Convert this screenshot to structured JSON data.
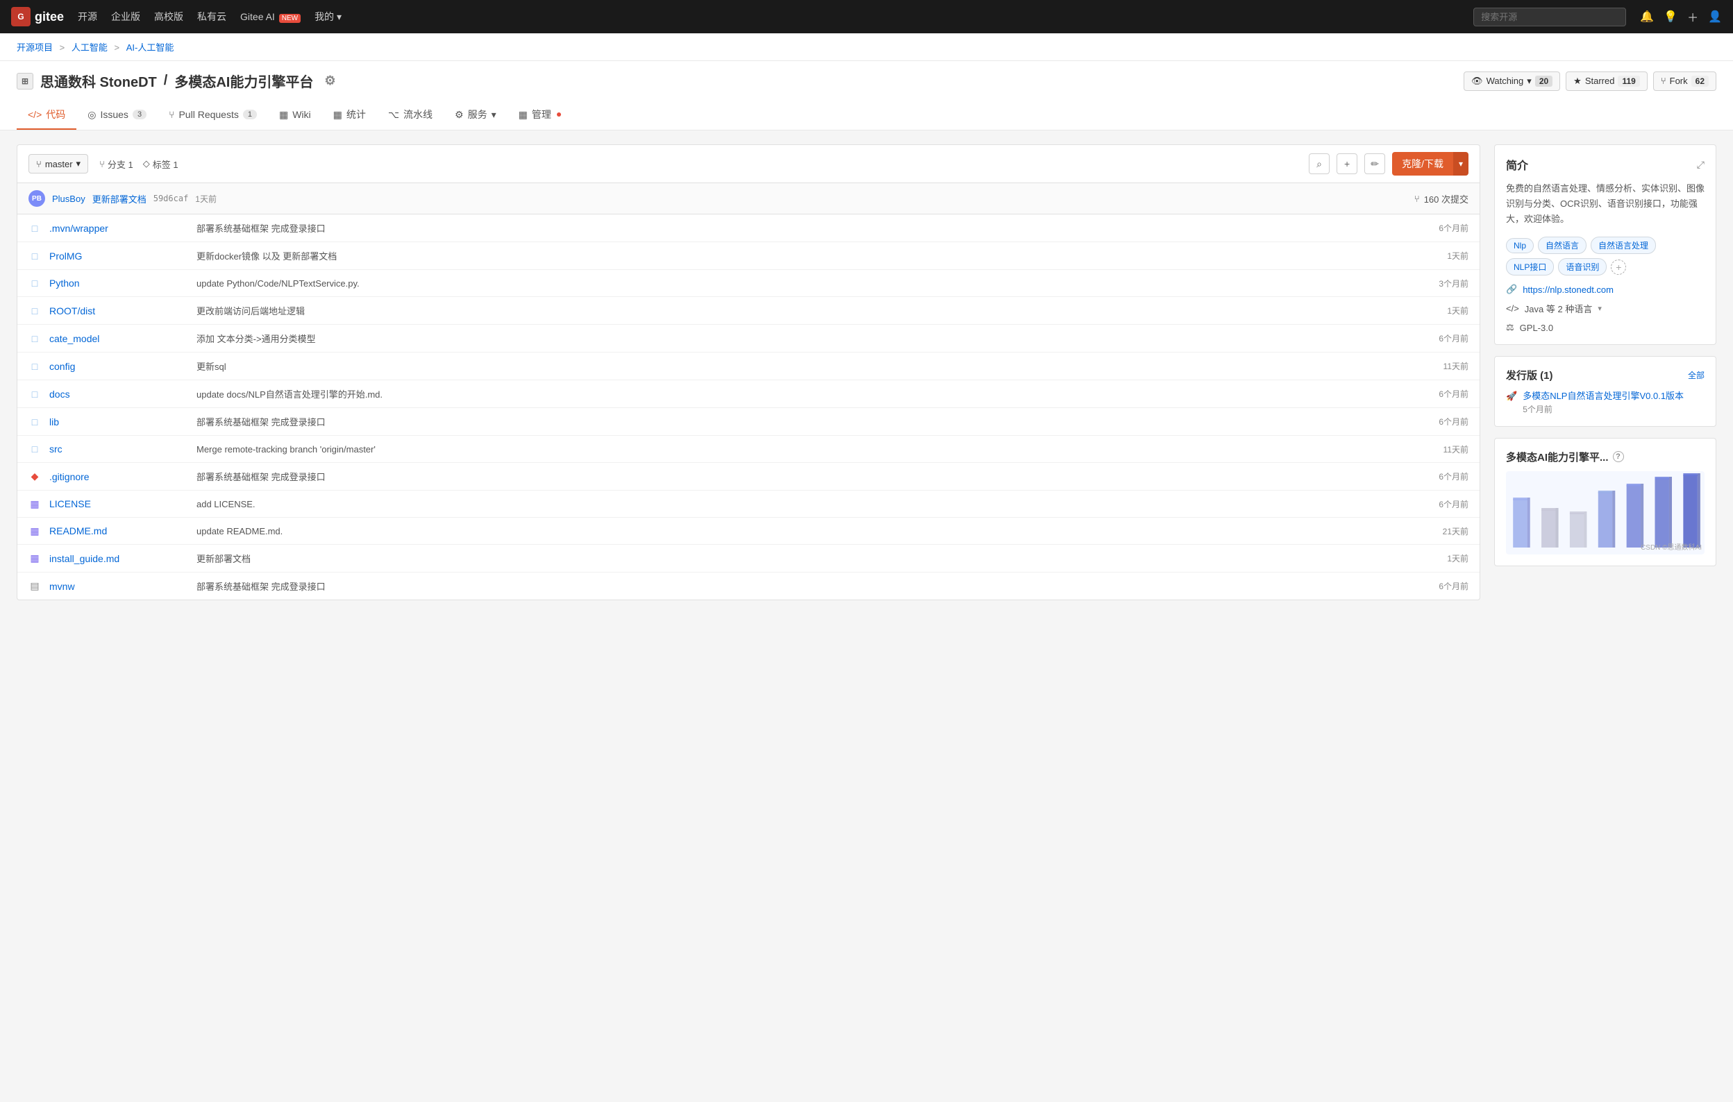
{
  "nav": {
    "logo_text": "gitee",
    "items": [
      "开源",
      "企业版",
      "高校版",
      "私有云",
      "Gitee AI",
      "我的"
    ],
    "ai_badge": "NEW",
    "search_placeholder": "搜索开源",
    "my_icon": "▾"
  },
  "breadcrumb": {
    "items": [
      "开源项目",
      "人工智能",
      "AI-人工智能"
    ]
  },
  "repo": {
    "icon": "⊞",
    "owner": "思通数科 StoneDT",
    "separator": "/",
    "name": "多模态AI能力引擎平台",
    "settings_icon": "⚙",
    "watching_label": "Watching",
    "watching_count": "20",
    "starred_label": "Starred",
    "starred_count": "119",
    "fork_label": "Fork",
    "fork_count": "62"
  },
  "tabs": [
    {
      "label": "代码",
      "icon": "</>",
      "active": true
    },
    {
      "label": "Issues",
      "badge": "3"
    },
    {
      "label": "Pull Requests",
      "badge": "1"
    },
    {
      "label": "Wiki",
      "icon": "▦"
    },
    {
      "label": "统计",
      "icon": "▦"
    },
    {
      "label": "流水线",
      "icon": "⌥"
    },
    {
      "label": "服务",
      "icon": "⚙",
      "has_arrow": true
    },
    {
      "label": "管理",
      "icon": "▦",
      "has_dot": true
    }
  ],
  "branch": {
    "name": "master",
    "branches": "分支 1",
    "tags": "标签 1",
    "clone_label": "克隆/下载"
  },
  "commit": {
    "author": "PlusBoy",
    "avatar_initials": "PB",
    "message": "更新部署文档",
    "hash": "59d6caf",
    "time": "1天前",
    "commit_count": "160 次提交"
  },
  "files": [
    {
      "type": "folder",
      "name": ".mvn/wrapper",
      "commit": "部署系统基础框架 完成登录接口",
      "time": "6个月前"
    },
    {
      "type": "folder",
      "name": "ProlMG",
      "commit": "更新docker镜像 以及 更新部署文档",
      "time": "1天前"
    },
    {
      "type": "folder",
      "name": "Python",
      "commit": "update Python/Code/NLPTextService.py.",
      "time": "3个月前"
    },
    {
      "type": "folder",
      "name": "ROOT/dist",
      "commit": "更改前端访问后端地址逻辑",
      "time": "1天前"
    },
    {
      "type": "folder",
      "name": "cate_model",
      "commit": "添加 文本分类->通用分类模型",
      "time": "6个月前"
    },
    {
      "type": "folder",
      "name": "config",
      "commit": "更新sql",
      "time": "11天前"
    },
    {
      "type": "folder",
      "name": "docs",
      "commit": "update docs/NLP自然语言处理引擎的开始.md.",
      "time": "6个月前"
    },
    {
      "type": "folder",
      "name": "lib",
      "commit": "部署系统基础框架 完成登录接口",
      "time": "6个月前"
    },
    {
      "type": "folder",
      "name": "src",
      "commit": "Merge remote-tracking branch 'origin/master'",
      "time": "11天前"
    },
    {
      "type": "gitignore",
      "name": ".gitignore",
      "commit": "部署系统基础框架 完成登录接口",
      "time": "6个月前"
    },
    {
      "type": "license",
      "name": "LICENSE",
      "commit": "add LICENSE.",
      "time": "6个月前"
    },
    {
      "type": "readme",
      "name": "README.md",
      "commit": "update README.md.",
      "time": "21天前"
    },
    {
      "type": "guide",
      "name": "install_guide.md",
      "commit": "更新部署文档",
      "time": "1天前"
    },
    {
      "type": "mvnw",
      "name": "mvnw",
      "commit": "部署系统基础框架 完成登录接口",
      "time": "6个月前"
    }
  ],
  "sidebar": {
    "intro_title": "简介",
    "desc": "免费的自然语言处理、情感分析、实体识别、图像识别与分类、OCR识别、语音识别接口，功能强大，欢迎体验。",
    "tags": [
      "Nlp",
      "自然语言",
      "自然语言处理",
      "NLP接口",
      "语音识别"
    ],
    "link": "https://nlp.stonedt.com",
    "lang": "Java 等 2 种语言",
    "license": "GPL-3.0",
    "release_title": "发行版 (1)",
    "release_all": "全部",
    "release_name": "多模态NLP自然语言处理引擎V0.0.1版本",
    "release_time": "5个月前",
    "chart_title": "多模态AI能力引擎平...",
    "chart_help": "?",
    "chart_watermark": "CSDN ©思通数科AI"
  },
  "icons": {
    "folder": "□",
    "file_code": "◫",
    "link": "🔗",
    "code": "</>",
    "scale": "⚖",
    "tag": "🏷",
    "rocket": "🚀",
    "eye": "👁",
    "star": "★",
    "fork": "⑂",
    "search": "⌕",
    "plus": "+",
    "clone": "⎘",
    "commit_count": "⑂",
    "branch_icon": "⑂",
    "tag_icon": "◇"
  }
}
